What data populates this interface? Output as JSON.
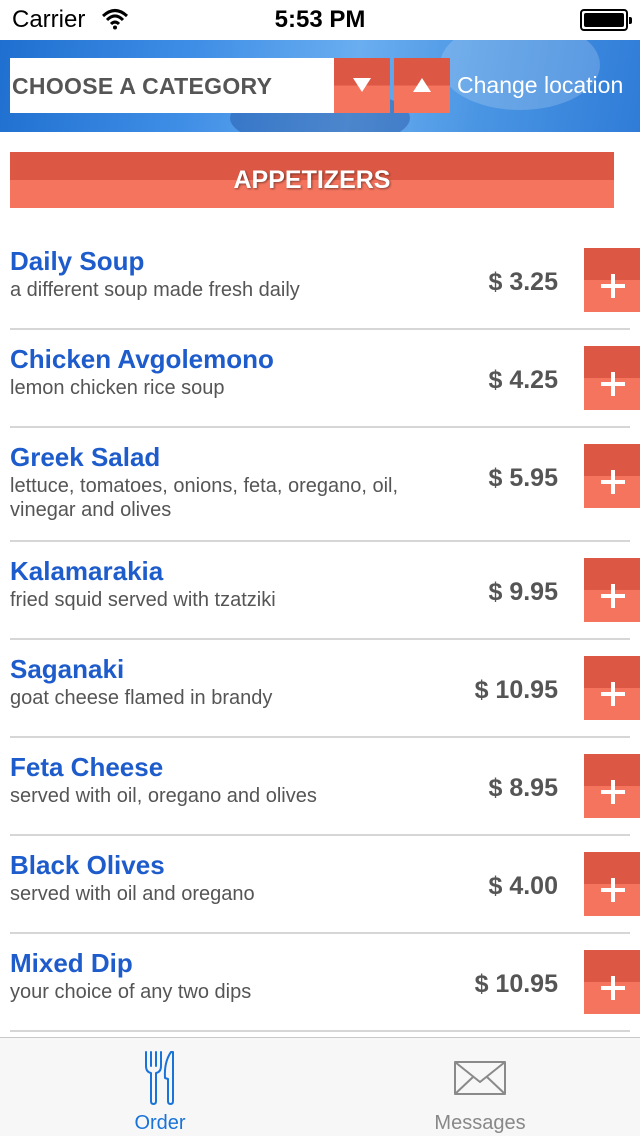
{
  "status_bar": {
    "carrier": "Carrier",
    "time": "5:53 PM"
  },
  "header": {
    "category_placeholder": "CHOOSE A CATEGORY",
    "change_location": "Change location"
  },
  "section": {
    "title": "APPETIZERS"
  },
  "colors": {
    "accent": "#dc5844",
    "accent_light": "#f4745e",
    "item_name": "#1e5ccc",
    "tab_active": "#1a73d8"
  },
  "menu": {
    "items": [
      {
        "name": "Daily Soup",
        "description": "a different soup made fresh daily",
        "price": "$ 3.25"
      },
      {
        "name": "Chicken Avgolemono",
        "description": "lemon chicken rice soup",
        "price": "$ 4.25"
      },
      {
        "name": "Greek Salad",
        "description": "lettuce, tomatoes, onions, feta, oregano, oil, vinegar and olives",
        "price": "$ 5.95"
      },
      {
        "name": "Kalamarakia",
        "description": "fried squid served with tzatziki",
        "price": "$ 9.95"
      },
      {
        "name": "Saganaki",
        "description": "goat cheese flamed in brandy",
        "price": "$ 10.95"
      },
      {
        "name": "Feta Cheese",
        "description": "served with oil, oregano and olives",
        "price": "$ 8.95"
      },
      {
        "name": "Black Olives",
        "description": "served with oil and oregano",
        "price": "$ 4.00"
      },
      {
        "name": "Mixed Dip",
        "description": "your choice of any two dips",
        "price": "$ 10.95"
      }
    ]
  },
  "tabs": [
    {
      "label": "Order",
      "icon": "fork-knife-icon",
      "active": true
    },
    {
      "label": "Messages",
      "icon": "envelope-icon",
      "active": false
    }
  ]
}
